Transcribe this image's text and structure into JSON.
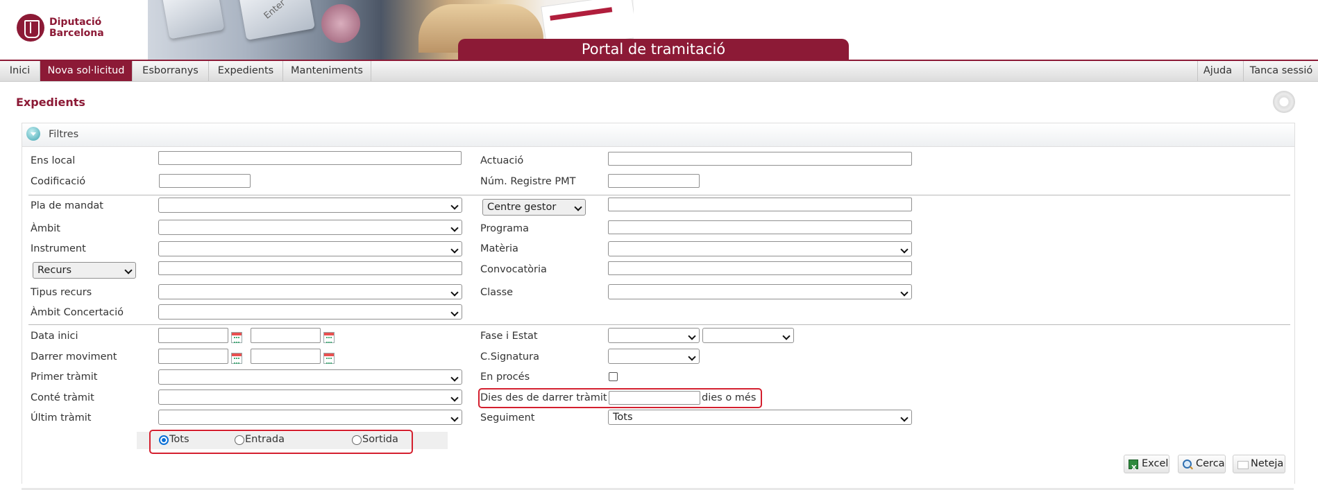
{
  "header": {
    "logo_line1": "Diputació",
    "logo_line2": "Barcelona",
    "banner_key_text": "Enter",
    "portal_title": "Portal de tramitació"
  },
  "nav": {
    "items": [
      "Inici",
      "Nova sol·licitud",
      "Esborranys",
      "Expedients",
      "Manteniments"
    ],
    "active": "Nova sol·licitud",
    "right_items": [
      "Ajuda",
      "Tanca sessió"
    ]
  },
  "page": {
    "title": "Expedients"
  },
  "filters": {
    "title": "Filtres",
    "labels": {
      "ens_local": "Ens local",
      "codificacio": "Codificació",
      "actuacio": "Actuació",
      "num_registre": "Núm. Registre PMT",
      "pla_mandat": "Pla de mandat",
      "ambit": "Àmbit",
      "instrument": "Instrument",
      "tipus_recurs": "Tipus recurs",
      "ambit_concertacio": "Àmbit Concertació",
      "programa": "Programa",
      "materia": "Matèria",
      "convocatoria": "Convocatòria",
      "classe": "Classe",
      "data_inici": "Data inici",
      "darrer_moviment": "Darrer moviment",
      "primer_tramit": "Primer tràmit",
      "conte_tramit": "Conté tràmit",
      "ultim_tramit": "Últim tràmit",
      "fase_estat": "Fase i Estat",
      "c_signatura": "C.Signatura",
      "en_proces": "En procés",
      "dies_darrer_tramit": "Dies des de darrer tràmit",
      "dies_suffix": "dies o més",
      "seguiment": "Seguiment"
    },
    "selects": {
      "centre_gestor": "Centre gestor",
      "recurs": "Recurs",
      "seguiment_value": "Tots"
    },
    "radios": {
      "options": [
        "Tots",
        "Entrada",
        "Sortida"
      ],
      "selected": "Tots"
    },
    "en_proces_checked": false
  },
  "buttons": {
    "excel": "Excel",
    "cerca": "Cerca",
    "neteja": "Neteja"
  },
  "colors": {
    "brand": "#8c1a36",
    "highlight": "#d41f2e"
  }
}
